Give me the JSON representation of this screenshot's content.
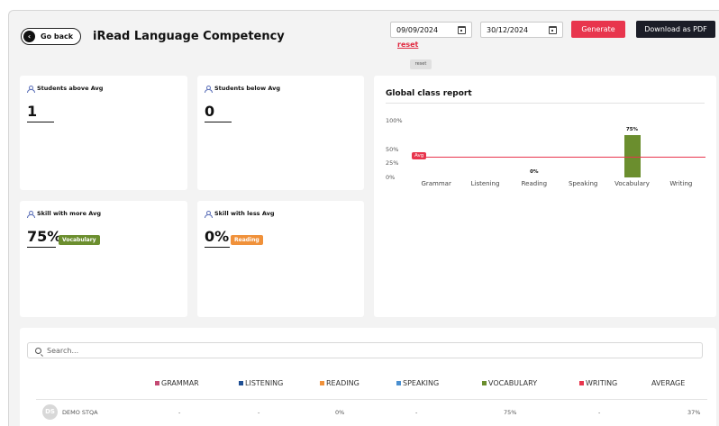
{
  "header": {
    "go_back_label": "Go back",
    "title": "iRead Language Competency",
    "start_date": "09/09/2024",
    "end_date": "30/12/2024",
    "reset_link": "reset",
    "reset_chip": "reset",
    "generate_label": "Generate",
    "download_label": "Download as PDF"
  },
  "cards": {
    "above_avg": {
      "title": "Students above Avg",
      "value": "1"
    },
    "below_avg": {
      "title": "Students below Avg",
      "value": "0"
    },
    "more_avg": {
      "title": "Skill with more Avg",
      "value": "75%",
      "skill": "Vocabulary",
      "color": "#6b8e2e"
    },
    "less_avg": {
      "title": "Skill with less Avg",
      "value": "0%",
      "skill": "Reading",
      "color": "#f0913a"
    }
  },
  "chart_data": {
    "type": "bar",
    "title": "Global class report",
    "categories": [
      "Grammar",
      "Listening",
      "Reading",
      "Speaking",
      "Vocabulary",
      "Writing"
    ],
    "values": [
      null,
      null,
      0,
      null,
      75,
      null
    ],
    "value_labels": [
      "",
      "",
      "0%",
      "",
      "75%",
      ""
    ],
    "y_ticks": [
      "100%",
      "50%",
      "25%",
      "0%"
    ],
    "y_tick_values": [
      100,
      50,
      25,
      0
    ],
    "ylim": [
      0,
      100
    ],
    "avg_label": "Avg",
    "avg_value": 37,
    "bar_color": "#6b8e2e",
    "avg_color": "#e8354d"
  },
  "table": {
    "search_placeholder": "Search...",
    "columns": [
      {
        "label": "GRAMMAR",
        "color": "#c44a73"
      },
      {
        "label": "LISTENING",
        "color": "#1f4f94"
      },
      {
        "label": "READING",
        "color": "#f0913a"
      },
      {
        "label": "SPEAKING",
        "color": "#4a8fd0"
      },
      {
        "label": "VOCABULARY",
        "color": "#6b8e2e"
      },
      {
        "label": "WRITING",
        "color": "#e8354d"
      },
      {
        "label": "AVERAGE",
        "color": ""
      }
    ],
    "rows": [
      {
        "initials": "DS",
        "name": "DEMO STQA",
        "cells": [
          "-",
          "-",
          "0%",
          "-",
          "75%",
          "-",
          "37%"
        ]
      }
    ]
  }
}
